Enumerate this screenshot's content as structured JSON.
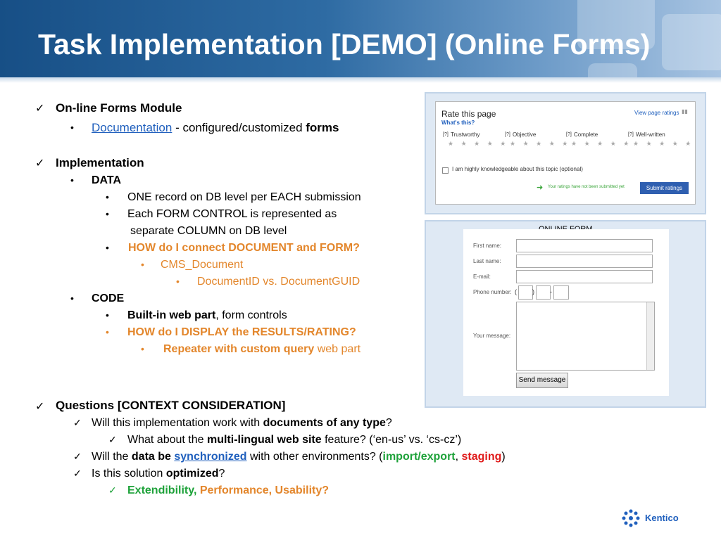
{
  "title": "Task Implementation [DEMO] (Online Forms)",
  "bullets": {
    "l1": "On-line Forms Module",
    "l2_link": "Documentation",
    "l2_mid": " - configured/customized ",
    "l2_bold": "forms",
    "l3": "Implementation",
    "l4": "DATA",
    "l5": "ONE record on DB level per EACH submission",
    "l6": "Each FORM CONTROL is represented as",
    "l7": "separate COLUMN on DB level",
    "l8": "HOW do I connect DOCUMENT and FORM?",
    "l9": "CMS_Document",
    "l10": "DocumentID vs. DocumentGUID",
    "l11": "CODE",
    "l12_bold": "Built-in web part",
    "l12_rest": ", form controls",
    "l13": "HOW do I DISPLAY the RESULTS/RATING?",
    "l14_bold": "Repeater with custom query",
    "l14_rest": " web part",
    "q0": "Questions [CONTEXT CONSIDERATION]",
    "q1_a": "Will this implementation work with ",
    "q1_b": "documents of any type",
    "q1_c": "?",
    "q2_a": "What about the ",
    "q2_b": "multi-lingual web site",
    "q2_c": " feature? (‘en-us’ vs. ‘cs-cz’)",
    "q3_a": "Will the ",
    "q3_b": "data be ",
    "q3_link": "synchronized",
    "q3_c": " with other environments? (",
    "q3_green": "import/export",
    "q3_comma": ", ",
    "q3_red": "staging",
    "q3_end": ")",
    "q4_a": "Is this solution ",
    "q4_b": "optimized",
    "q4_c": "?",
    "q5_green": "Extendibility,",
    "q5_orange": " Performance, Usability?"
  },
  "rating": {
    "heading": "Rate this page",
    "whats": "What's this?",
    "view": "View page ratings",
    "c1": "Trustworthy",
    "c2": "Objective",
    "c3": "Complete",
    "c4": "Well-written",
    "stars": "★ ★ ★ ★ ★",
    "checkbox_label": "I am highly knowledgeable about this topic (optional)",
    "notice": "Your ratings have not been submitted yet",
    "submit": "Submit ratings"
  },
  "form": {
    "caption": "ONLINE FORM",
    "first": "First name:",
    "last": "Last name:",
    "email": "E-mail:",
    "phone": "Phone number:",
    "message": "Your message:",
    "send": "Send message"
  },
  "logo": "Kentico"
}
